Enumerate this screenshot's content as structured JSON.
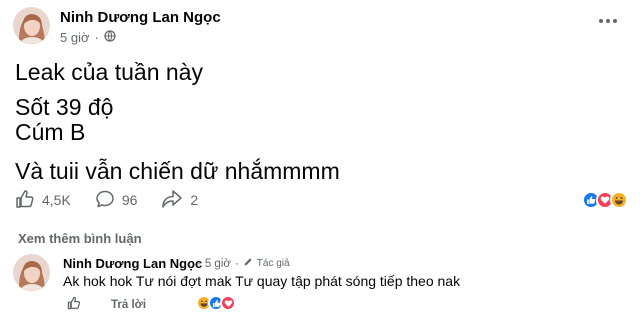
{
  "post": {
    "author": "Ninh Dương Lan Ngọc",
    "time": "5 giờ",
    "dot": "·",
    "lines": [
      "Leak của tuần này",
      "Sốt 39 độ",
      "Cúm B",
      "Và tuii vẫn chiến dữ nhắmmmm"
    ]
  },
  "stats": {
    "likes": "4,5K",
    "comments": "96",
    "shares": "2"
  },
  "reaction_icons": [
    "like-icon",
    "love-icon",
    "haha-icon"
  ],
  "comments_section": {
    "see_more": "Xem thêm bình luận",
    "comment": {
      "author": "Ninh Dương Lan Ngọc",
      "time": "5 giờ",
      "dot": "·",
      "badge": "Tác giả",
      "text": "Ak hok hok Tư nói đợt mak Tư quay tập phát sóng tiếp theo nak",
      "reply_label": "Trả lời"
    }
  },
  "colors": {
    "like_blue": "#1877f2",
    "love_red": "#f33e58",
    "haha_yellow": "#f7b125",
    "secondary_text": "#65676b"
  }
}
